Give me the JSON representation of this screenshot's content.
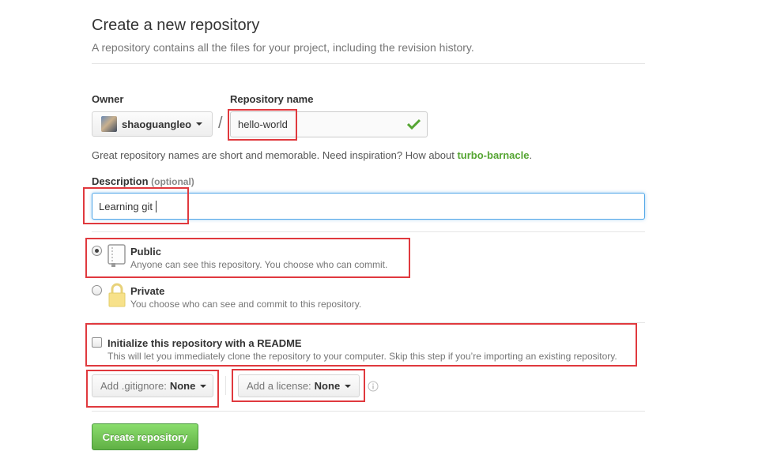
{
  "header": {
    "title": "Create a new repository",
    "subtitle": "A repository contains all the files for your project, including the revision history."
  },
  "owner": {
    "label": "Owner",
    "selected": "shaoguangleo"
  },
  "separator": "/",
  "repo_name": {
    "label": "Repository name",
    "value": "hello-world"
  },
  "hint": {
    "text": "Great repository names are short and memorable. Need inspiration? How about ",
    "suggestion": "turbo-barnacle",
    "end": "."
  },
  "description": {
    "label": "Description",
    "optional": "(optional)",
    "value": "Learning git"
  },
  "visibility": {
    "public": {
      "title": "Public",
      "desc": "Anyone can see this repository. You choose who can commit.",
      "checked": true
    },
    "private": {
      "title": "Private",
      "desc": "You choose who can see and commit to this repository.",
      "checked": false
    }
  },
  "readme": {
    "title": "Initialize this repository with a README",
    "desc": "This will let you immediately clone the repository to your computer. Skip this step if you’re importing an existing repository.",
    "checked": false
  },
  "gitignore": {
    "prefix": "Add .gitignore:",
    "value": "None"
  },
  "license": {
    "prefix": "Add a license:",
    "value": "None"
  },
  "submit": {
    "label": "Create repository"
  },
  "colors": {
    "accent_green": "#55a532",
    "highlight_red": "#e0393e",
    "focus_blue": "#51a7e8",
    "check_green": "#55a532"
  }
}
